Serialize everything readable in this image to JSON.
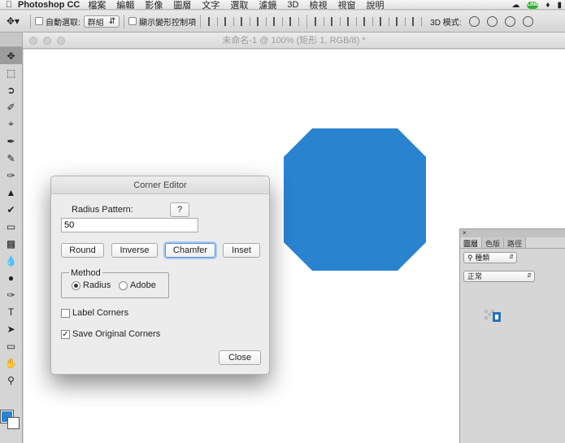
{
  "menubar": {
    "app_name": "Photoshop CC",
    "items": [
      "檔案",
      "編輯",
      "影像",
      "圖層",
      "文字",
      "選取",
      "濾鏡",
      "3D",
      "檢視",
      "視窗",
      "說明"
    ],
    "status_badge": "LINE"
  },
  "options_bar": {
    "auto_select_label": "自動選取:",
    "auto_select_value": "群組",
    "transform_controls_label": "顯示變形控制項",
    "mode_3d_label": "3D 模式:"
  },
  "document": {
    "title": "未命名-1 @ 100% (矩形 1, RGB/8) *",
    "shape_color": "#2a83cf"
  },
  "dialog": {
    "title": "Corner Editor",
    "radius_pattern_label": "Radius Pattern:",
    "help_button": "?",
    "radius_value": "50",
    "buttons": {
      "round": "Round",
      "inverse": "Inverse",
      "chamfer": "Chamfer",
      "inset": "Inset"
    },
    "method_label": "Method",
    "method_options": {
      "radius": "Radius",
      "adobe": "Adobe"
    },
    "selected_method": "Radius",
    "label_corners": "Label Corners",
    "label_corners_checked": false,
    "save_original_corners": "Save Original Corners",
    "save_original_checked": true,
    "close_button": "Close"
  },
  "layers_panel": {
    "tabs": [
      "圖層",
      "色版",
      "路徑"
    ],
    "active_tab": "圖層",
    "filter_kind": "種類",
    "blend_mode": "正常"
  },
  "colors": {
    "foreground": "#2a83cf",
    "background": "#ffffff",
    "focus_ring": "#5b93d8"
  }
}
